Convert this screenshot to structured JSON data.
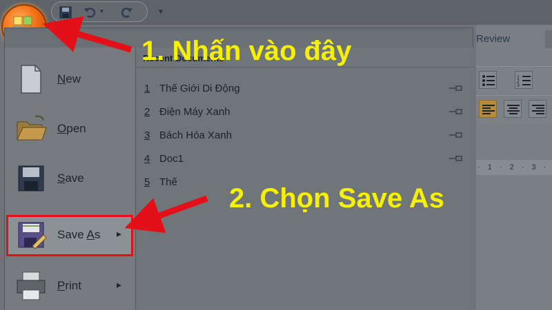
{
  "ribbon": {
    "tab_review": "Review",
    "ruler_text": "· 1 · 2 · 3 ·"
  },
  "menu": {
    "items": [
      {
        "label": "New",
        "accel": "N"
      },
      {
        "label": "Open",
        "accel": "O"
      },
      {
        "label": "Save",
        "accel": "S"
      },
      {
        "label": "Save As",
        "accel": "A"
      },
      {
        "label": "Print",
        "accel": "P"
      }
    ],
    "recent_title": "Recent Documents",
    "recent": [
      {
        "num": "1",
        "name": "Thế Giới Di Động"
      },
      {
        "num": "2",
        "name": "Điện Máy Xanh"
      },
      {
        "num": "3",
        "name": "Bách Hóa Xanh"
      },
      {
        "num": "4",
        "name": "Doc1"
      },
      {
        "num": "5",
        "name": "Thế"
      }
    ]
  },
  "annotations": {
    "step1": "1. Nhấn vào đây",
    "step2": "2. Chọn Save As"
  },
  "colors": {
    "annotation": "#f6f100",
    "arrow": "#e3101a",
    "office_button": "#f06f14"
  }
}
